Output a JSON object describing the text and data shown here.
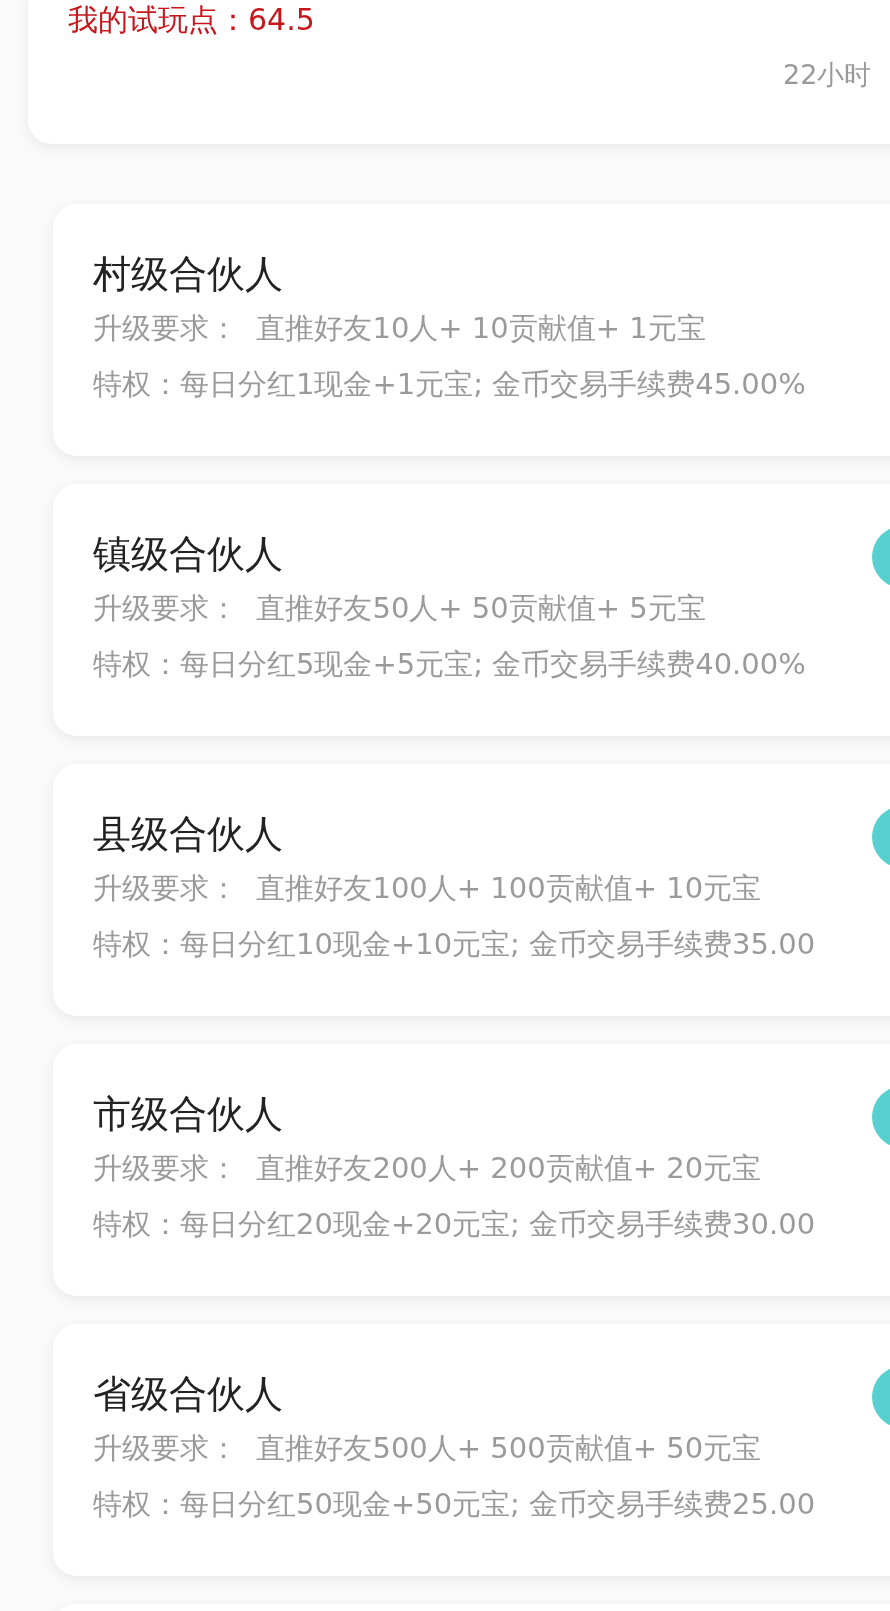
{
  "header_card": {
    "trial_points": "我的试玩点：64.5",
    "time": "22小时"
  },
  "levels": [
    {
      "kind": "current",
      "title": "村级合伙人",
      "requirement": "升级要求：  直推好友10人+ 10贡献值+ 1元宝",
      "privilege": "特权：每日分红1现金+1元宝; 金币交易手续费45.00%"
    },
    {
      "kind": "upgradeable",
      "title": "镇级合伙人",
      "requirement": "升级要求：  直推好友50人+ 50贡献值+ 5元宝",
      "privilege": "特权：每日分红5现金+5元宝; 金币交易手续费40.00%"
    },
    {
      "kind": "upgradeable",
      "title": "县级合伙人",
      "requirement": "升级要求：  直推好友100人+ 100贡献值+ 10元宝",
      "privilege": "特权：每日分红10现金+10元宝; 金币交易手续费35.00"
    },
    {
      "kind": "upgradeable",
      "title": "市级合伙人",
      "requirement": "升级要求：  直推好友200人+ 200贡献值+ 20元宝",
      "privilege": "特权：每日分红20现金+20元宝; 金币交易手续费30.00"
    },
    {
      "kind": "upgradeable",
      "title": "省级合伙人",
      "requirement": "升级要求：  直推好友500人+ 500贡献值+ 50元宝",
      "privilege": "特权：每日分红50现金+50元宝; 金币交易手续费25.00"
    }
  ]
}
